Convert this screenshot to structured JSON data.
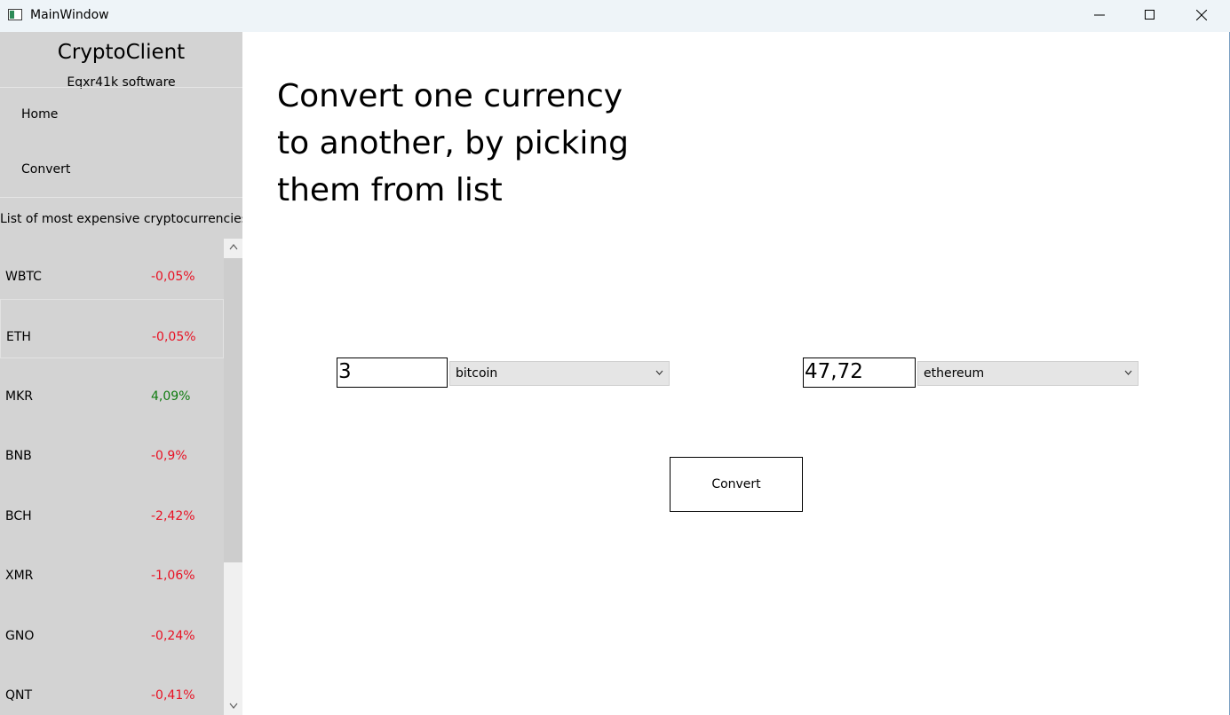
{
  "window": {
    "title": "MainWindow",
    "icons": [
      "app-window-icon",
      "minimize-icon",
      "maximize-icon",
      "close-icon"
    ]
  },
  "sidebar": {
    "app_name": "CryptoClient",
    "subtitle": "Eqxr41k software",
    "nav": [
      {
        "label": "Home"
      },
      {
        "label": "Convert"
      }
    ],
    "list_caption": "List of most expensive cryptocurrencies:",
    "items": [
      {
        "symbol": "WBTC",
        "change": "-0,05%",
        "trend": "down"
      },
      {
        "symbol": "ETH",
        "change": "-0,05%",
        "trend": "down"
      },
      {
        "symbol": "MKR",
        "change": "4,09%",
        "trend": "up"
      },
      {
        "symbol": "BNB",
        "change": "-0,9%",
        "trend": "down"
      },
      {
        "symbol": "BCH",
        "change": "-2,42%",
        "trend": "down"
      },
      {
        "symbol": "XMR",
        "change": "-1,06%",
        "trend": "down"
      },
      {
        "symbol": "GNO",
        "change": "-0,24%",
        "trend": "down"
      },
      {
        "symbol": "QNT",
        "change": "-0,41%",
        "trend": "down"
      }
    ],
    "scroll_position": 0.0
  },
  "main": {
    "heading": "Convert one currency to another, by picking them from list",
    "from": {
      "amount": "3",
      "currency": "bitcoin"
    },
    "to": {
      "amount": "47,72",
      "currency": "ethereum"
    },
    "convert_label": "Convert"
  },
  "colors": {
    "negative": "#e81123",
    "positive": "#107c10",
    "sidebar": "#d3d3d3"
  }
}
